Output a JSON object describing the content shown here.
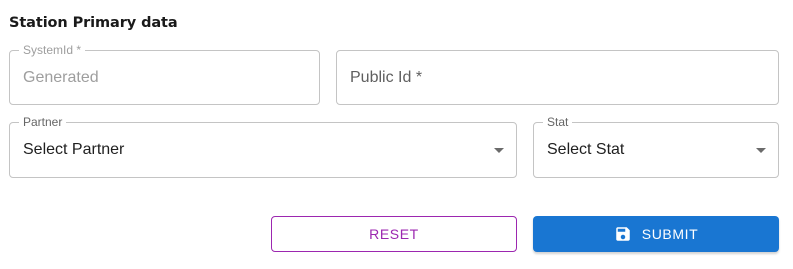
{
  "section": {
    "title": "Station Primary data"
  },
  "fields": {
    "system_id": {
      "label": "SystemId *",
      "value": "Generated"
    },
    "public_id": {
      "placeholder": "Public Id *"
    },
    "partner": {
      "label": "Partner",
      "value": "Select Partner"
    },
    "stat": {
      "label": "Stat",
      "value": "Select Stat"
    }
  },
  "actions": {
    "reset_label": "RESET",
    "submit_label": "SUBMIT"
  },
  "colors": {
    "reset_accent": "#9c27b0",
    "submit_background": "#1976d2",
    "field_border": "#c4c4c4"
  },
  "icons": {
    "submit": "save-icon",
    "select": "arrow-drop-down-icon"
  }
}
